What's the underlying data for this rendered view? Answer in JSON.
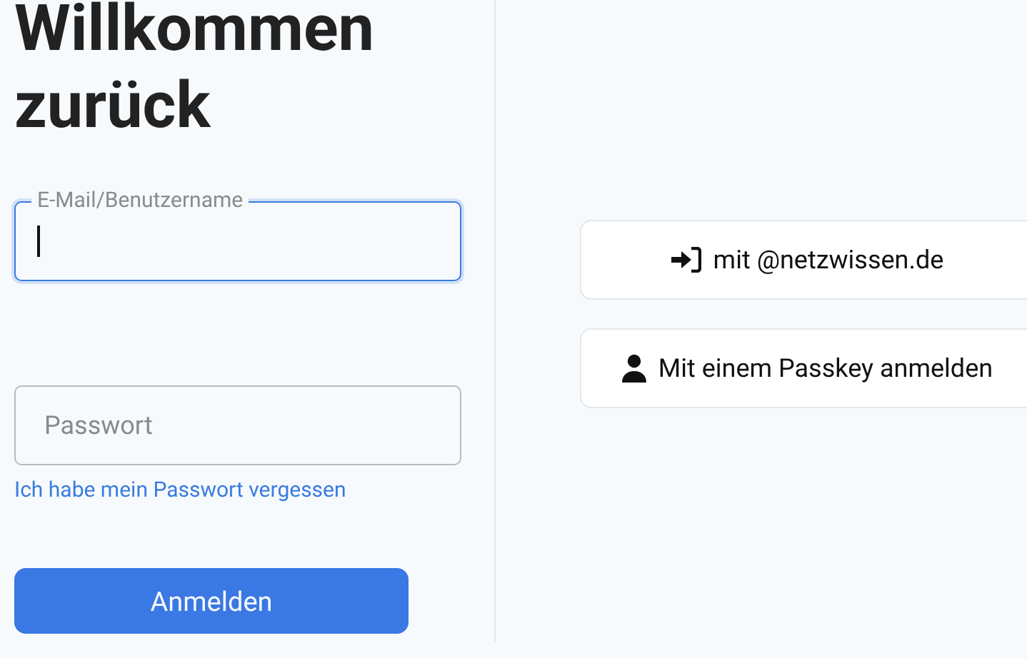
{
  "heading": "Willkommen zurück",
  "login_form": {
    "username_field": {
      "label": "E-Mail/Benutzername",
      "focused": true
    },
    "password_field": {
      "placeholder": "Passwort",
      "focused": false
    },
    "forgot_link": "Ich habe mein Passwort vergessen",
    "submit_button": "Anmelden"
  },
  "alternative_logins": [
    {
      "kind": "domain",
      "label": "mit @netzwissen.de"
    },
    {
      "kind": "passkey",
      "label": "Mit einem Passkey anmelden"
    }
  ]
}
